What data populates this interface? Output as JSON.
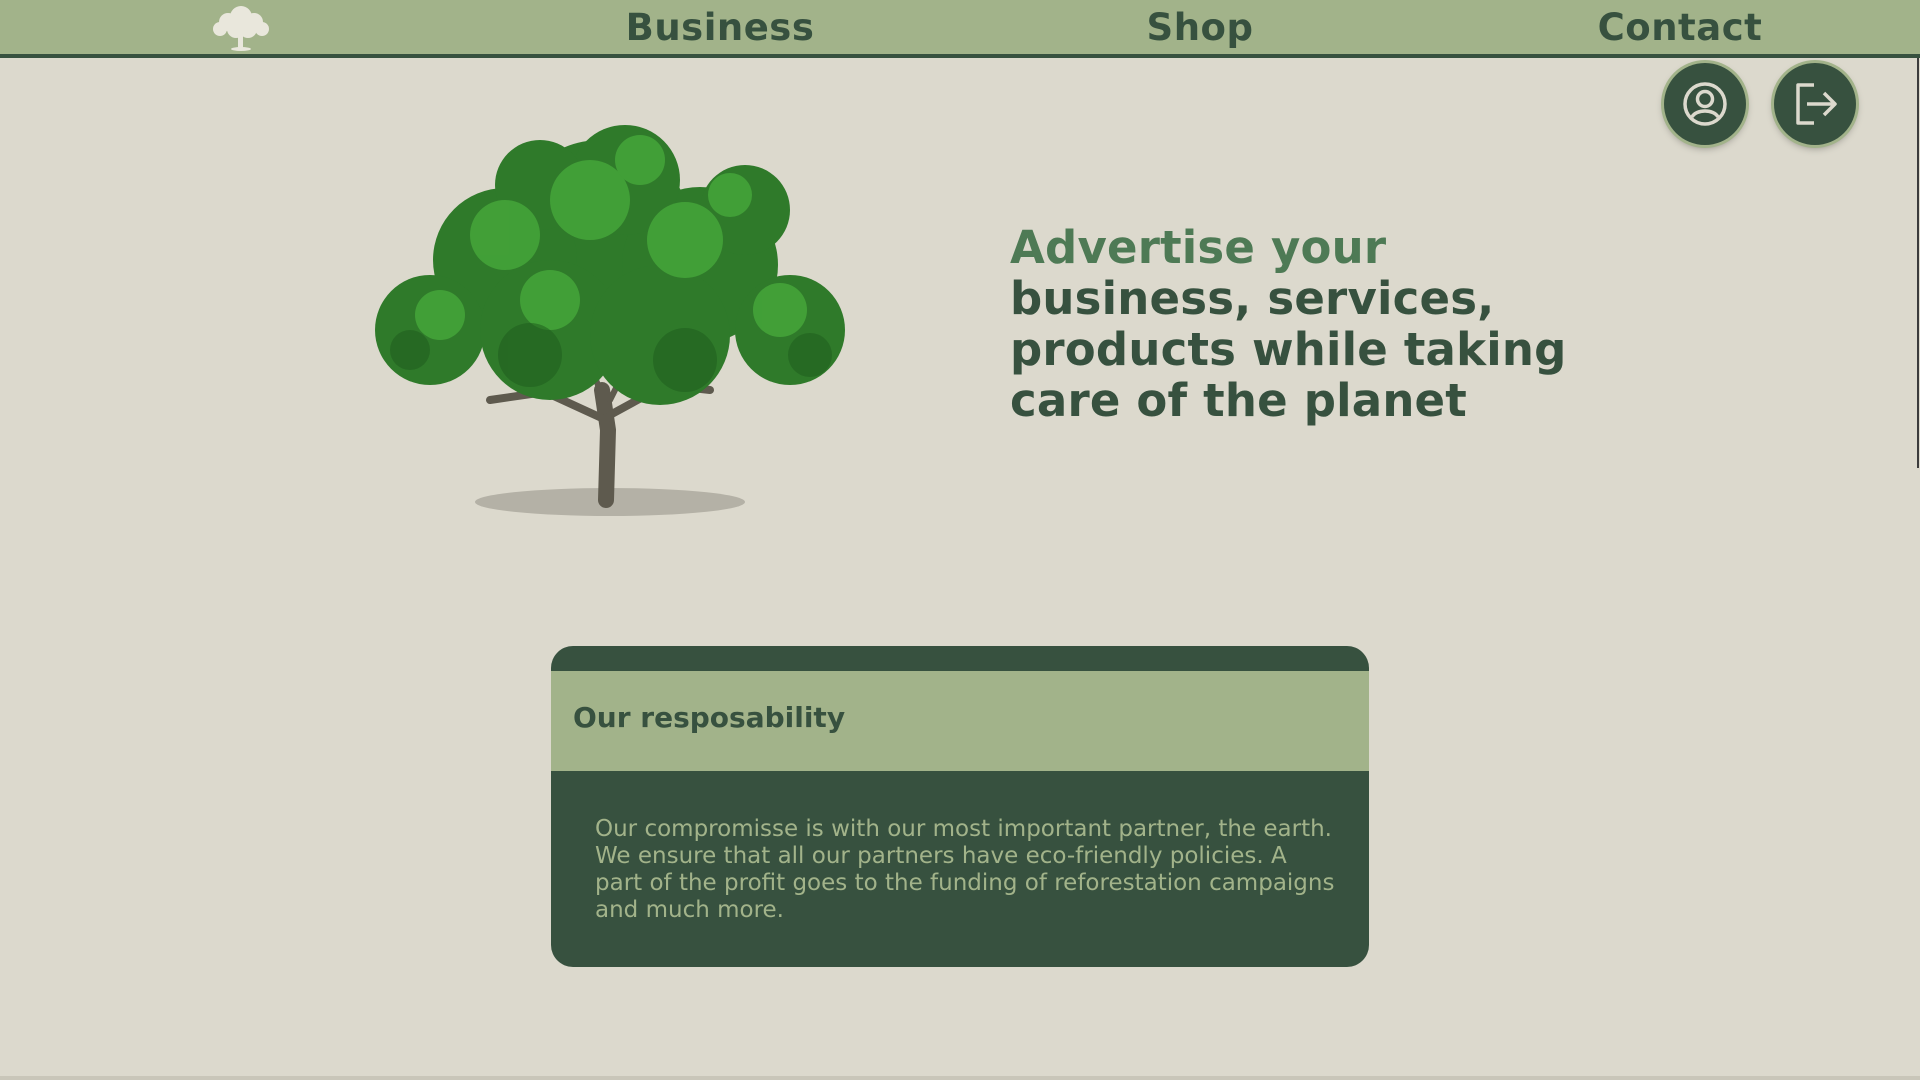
{
  "nav": {
    "items": [
      {
        "label": "Business"
      },
      {
        "label": "Shop"
      },
      {
        "label": "Contact"
      }
    ],
    "logo_icon": "tree-logo-icon"
  },
  "actions": {
    "profile_icon": "user-circle-icon",
    "logout_icon": "logout-icon"
  },
  "hero": {
    "image": "tree-illustration",
    "headline_line1": "Advertise your",
    "headline_rest": "business, services, products while taking care of the planet"
  },
  "responsibility": {
    "title": "Our resposability",
    "text": "Our compromisse is with our most important partner, the earth. We ensure that all our partners have eco-friendly policies. A part of the profit goes to the funding of reforestation campaigns and much more."
  },
  "colors": {
    "background": "#dcd9cd",
    "nav_bar": "#a2b38a",
    "dark_green": "#37513f",
    "accent_green": "#4e7a55"
  }
}
